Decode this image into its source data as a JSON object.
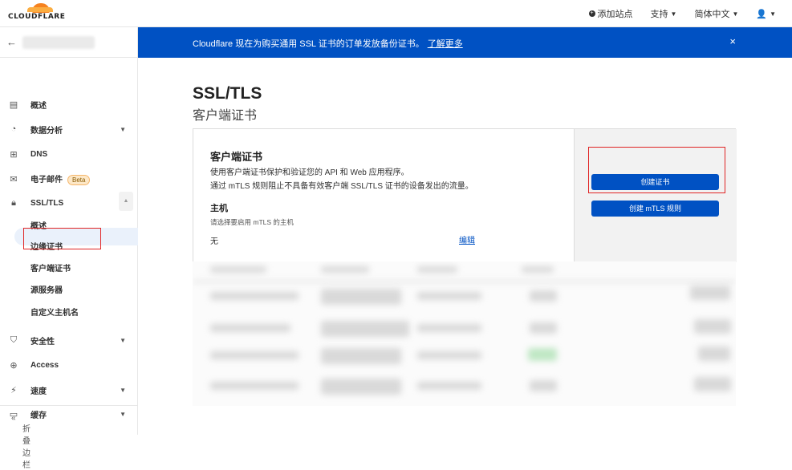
{
  "header": {
    "logo_text": "CLOUDFLARE",
    "add_site": "添加站点",
    "support": "支持",
    "language": "简体中文"
  },
  "sidebar": {
    "back_arrow": "←",
    "items": [
      {
        "icon": "document-icon",
        "glyph": "▤",
        "label": "概述"
      },
      {
        "icon": "analytics-icon",
        "glyph": "◔",
        "label": "数据分析"
      },
      {
        "icon": "dns-icon",
        "glyph": "⊞",
        "label": "DNS"
      },
      {
        "icon": "email-icon",
        "glyph": "✉",
        "label": "电子邮件",
        "badge": "Beta"
      },
      {
        "icon": "lock-icon",
        "glyph": "🔒",
        "label": "SSL/TLS"
      },
      {
        "label": "概述"
      },
      {
        "label": "边缘证书"
      },
      {
        "label": "客户端证书"
      },
      {
        "label": "源服务器"
      },
      {
        "label": "自定义主机名"
      },
      {
        "icon": "shield-icon",
        "glyph": "⛉",
        "label": "安全性"
      },
      {
        "icon": "access-icon",
        "glyph": "⊕",
        "label": "Access"
      },
      {
        "icon": "speed-icon",
        "glyph": "⚡",
        "label": "速度"
      },
      {
        "icon": "cache-icon",
        "glyph": "▭",
        "label": "缓存"
      }
    ],
    "footer": "折叠边栏"
  },
  "banner": {
    "text": "Cloudflare 现在为购买通用 SSL 证书的订单发放备份证书。",
    "link": "了解更多",
    "close": "×"
  },
  "page": {
    "title": "SSL/TLS",
    "subtitle": "客户端证书"
  },
  "card": {
    "title": "客户端证书",
    "desc1": "使用客户端证书保护和验证您的 API 和 Web 应用程序。",
    "desc2": "通过 mTLS 规则阻止不具备有效客户端 SSL/TLS 证书的设备发出的流量。",
    "host_label": "主机",
    "host_hint": "请选择要启用 mTLS 的主机",
    "host_value": "无",
    "edit": "编辑",
    "create_cert": "创建证书",
    "create_rule": "创建 mTLS 规则"
  },
  "colors": {
    "brand_blue": "#0051c3",
    "highlight_red": "#e02424",
    "cloud_orange": "#f6821f"
  }
}
